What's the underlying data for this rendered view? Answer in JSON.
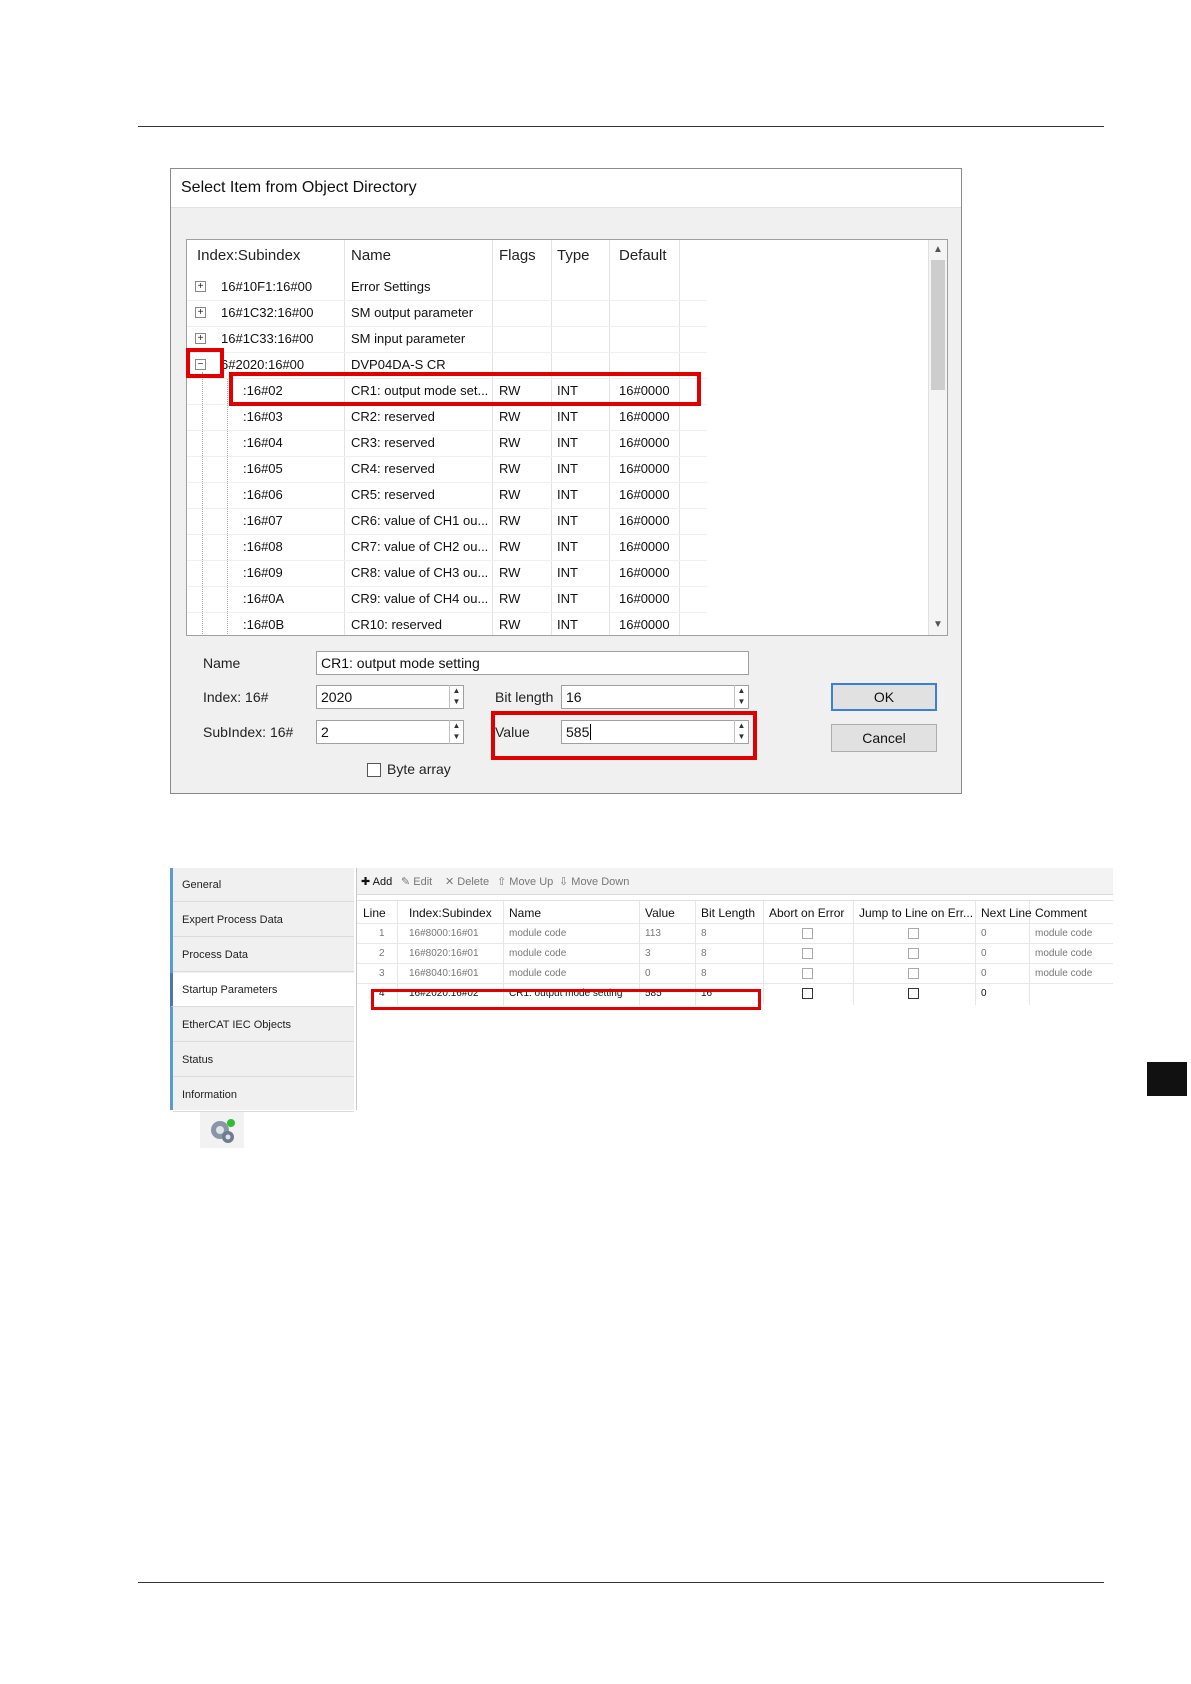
{
  "dialog": {
    "title": "Select Item from Object Directory",
    "columns": [
      "Index:Subindex",
      "Name",
      "Flags",
      "Type",
      "Default"
    ],
    "rows": [
      {
        "index": "16#10F1:16#00",
        "name": "Error Settings",
        "flags": "",
        "type": "",
        "default": "",
        "node": "expand"
      },
      {
        "index": "16#1C32:16#00",
        "name": "SM output parameter",
        "flags": "",
        "type": "",
        "default": "",
        "node": "expand"
      },
      {
        "index": "16#1C33:16#00",
        "name": "SM input parameter",
        "flags": "",
        "type": "",
        "default": "",
        "node": "expand"
      },
      {
        "index": "6#2020:16#00",
        "name": "DVP04DA-S CR",
        "flags": "",
        "type": "",
        "default": "",
        "node": "collapse"
      },
      {
        "index": ":16#02",
        "name": "CR1: output mode set...",
        "flags": "RW",
        "type": "INT",
        "default": "16#0000",
        "node": "child"
      },
      {
        "index": ":16#03",
        "name": "CR2: reserved",
        "flags": "RW",
        "type": "INT",
        "default": "16#0000",
        "node": "child"
      },
      {
        "index": ":16#04",
        "name": "CR3: reserved",
        "flags": "RW",
        "type": "INT",
        "default": "16#0000",
        "node": "child"
      },
      {
        "index": ":16#05",
        "name": "CR4: reserved",
        "flags": "RW",
        "type": "INT",
        "default": "16#0000",
        "node": "child"
      },
      {
        "index": ":16#06",
        "name": "CR5: reserved",
        "flags": "RW",
        "type": "INT",
        "default": "16#0000",
        "node": "child"
      },
      {
        "index": ":16#07",
        "name": "CR6: value of CH1 ou...",
        "flags": "RW",
        "type": "INT",
        "default": "16#0000",
        "node": "child"
      },
      {
        "index": ":16#08",
        "name": "CR7: value of CH2 ou...",
        "flags": "RW",
        "type": "INT",
        "default": "16#0000",
        "node": "child"
      },
      {
        "index": ":16#09",
        "name": "CR8: value of CH3 ou...",
        "flags": "RW",
        "type": "INT",
        "default": "16#0000",
        "node": "child"
      },
      {
        "index": ":16#0A",
        "name": "CR9: value of CH4 ou...",
        "flags": "RW",
        "type": "INT",
        "default": "16#0000",
        "node": "child"
      },
      {
        "index": ":16#0B",
        "name": "CR10: reserved",
        "flags": "RW",
        "type": "INT",
        "default": "16#0000",
        "node": "child"
      }
    ],
    "name_label": "Name",
    "name_value": "CR1: output mode setting",
    "index_label": "Index:  16#",
    "index_value": "2020",
    "subindex_label": "SubIndex: 16#",
    "subindex_value": "2",
    "bitlength_label": "Bit length",
    "bitlength_value": "16",
    "value_label": "Value",
    "value_value": "585",
    "byte_array_label": "Byte array",
    "ok_label": "OK",
    "cancel_label": "Cancel"
  },
  "startup": {
    "nav": [
      "General",
      "Expert Process Data",
      "Process Data",
      "Startup Parameters",
      "EtherCAT IEC Objects",
      "Status",
      "Information"
    ],
    "active_nav": "Startup Parameters",
    "toolbar": {
      "add": "Add",
      "edit": "Edit",
      "delete": "Delete",
      "move_up": "Move Up",
      "move_down": "Move Down"
    },
    "columns": [
      "Line",
      "Index:Subindex",
      "Name",
      "Value",
      "Bit Length",
      "Abort on Error",
      "Jump to Line on Err...",
      "Next Line",
      "Comment"
    ],
    "rows": [
      {
        "line": "1",
        "index": "16#8000:16#01",
        "name": "module code",
        "value": "113",
        "bitlen": "8",
        "next": "0",
        "comment": "module code"
      },
      {
        "line": "2",
        "index": "16#8020:16#01",
        "name": "module code",
        "value": "3",
        "bitlen": "8",
        "next": "0",
        "comment": "module code"
      },
      {
        "line": "3",
        "index": "16#8040:16#01",
        "name": "module code",
        "value": "0",
        "bitlen": "8",
        "next": "0",
        "comment": "module code"
      },
      {
        "line": "4",
        "index": "16#2020:16#02",
        "name": "CR1: output mode setting",
        "value": "585",
        "bitlen": "16",
        "next": "0",
        "comment": ""
      }
    ]
  },
  "colors": {
    "highlight": "#e00000",
    "accent": "#5b9bd5"
  }
}
